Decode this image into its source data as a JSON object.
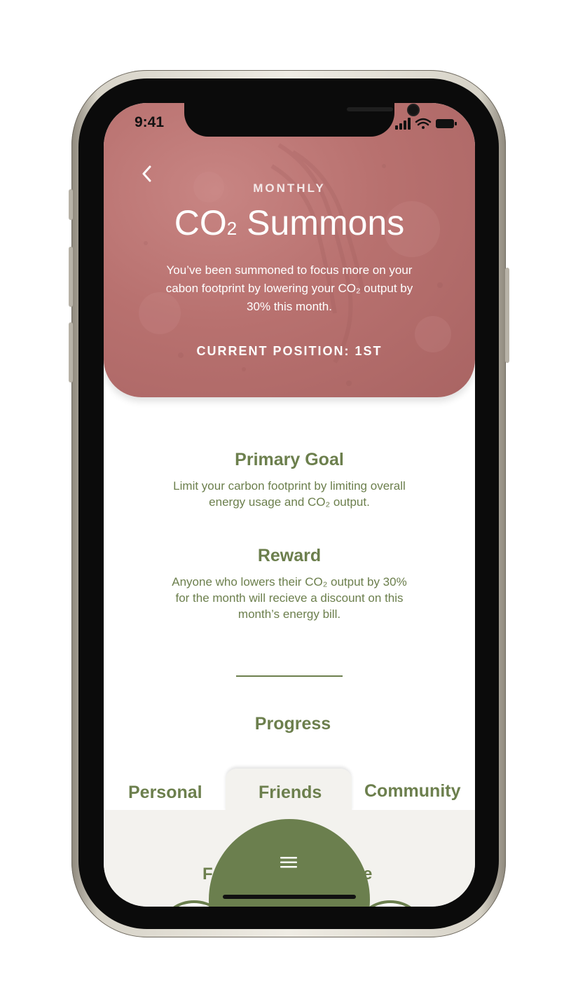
{
  "status_bar": {
    "time": "9:41"
  },
  "hero": {
    "subtitle": "MONTHLY",
    "title_main": "CO",
    "title_sub": "2",
    "title_rest": " Summons",
    "description": "You’ve been summoned to focus more on your cabon footprint by lowering your CO₂ output by 30% this month.",
    "position": "CURRENT POSITION: 1ST",
    "color": "#b8716f"
  },
  "primary_goal": {
    "title": "Primary Goal",
    "body": "Limit your carbon footprint by limiting overall energy usage and CO₂ output."
  },
  "reward": {
    "title": "Reward",
    "body": "Anyone who lowers their CO₂ output by 30% for the month will recieve a discount on this month’s energy bill."
  },
  "progress": {
    "title": "Progress"
  },
  "tabs": [
    {
      "label": "Personal",
      "active": false
    },
    {
      "label": "Friends",
      "active": true
    },
    {
      "label": "Community",
      "active": false
    }
  ],
  "peek_text": {
    "left": "F",
    "right": "e"
  },
  "icons": {
    "back": "chevron-left-icon",
    "menu": "hamburger-menu-icon"
  },
  "colors": {
    "accent": "#6b7f4e",
    "panel": "#f3f2ee"
  }
}
